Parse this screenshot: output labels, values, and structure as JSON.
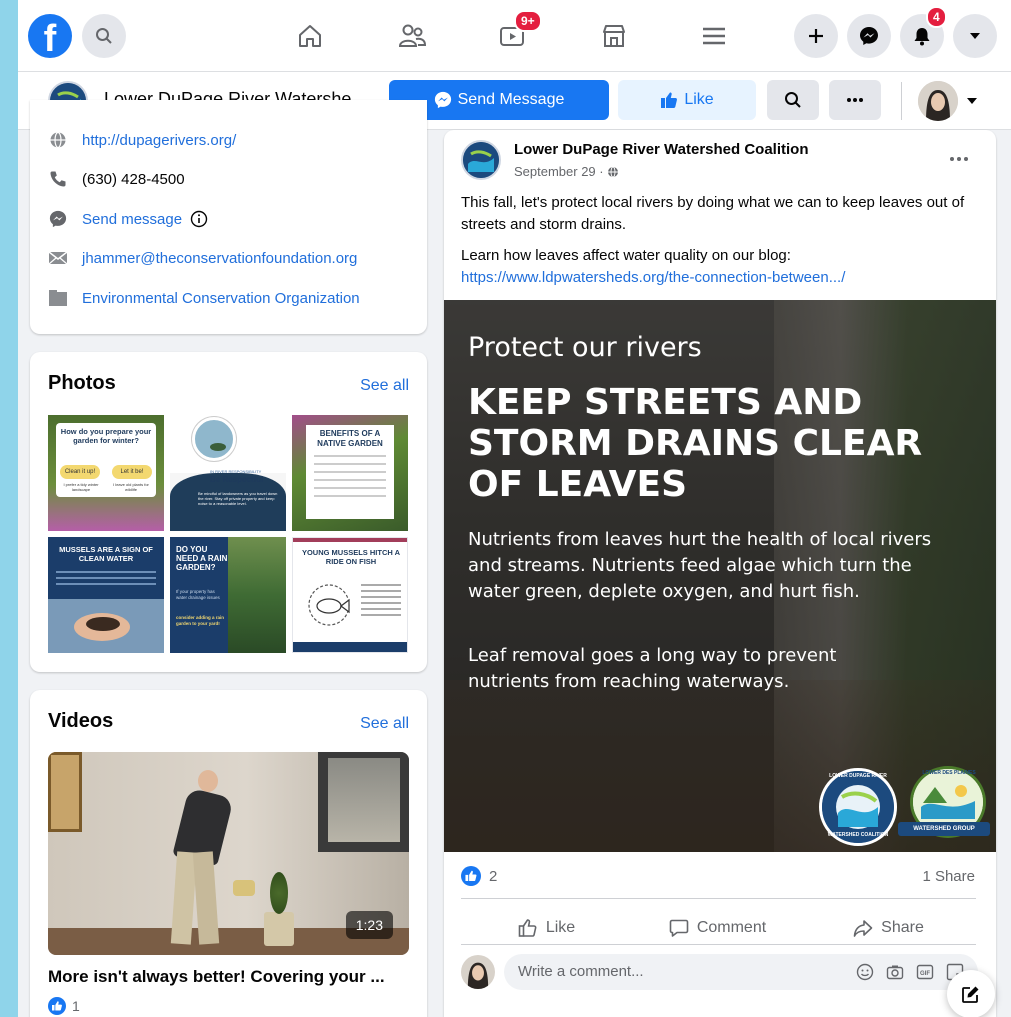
{
  "topbar": {
    "logo": "f",
    "notifications_badge": "4",
    "watch_badge": "9+"
  },
  "page_header": {
    "name": "Lower DuPage River Watershe...",
    "send_message": "Send Message",
    "like": "Like"
  },
  "intro": {
    "website": "http://dupagerivers.org/",
    "phone": "(630) 428-4500",
    "send_message": "Send message",
    "email": "jhammer@theconservationfoundation.org",
    "category": "Environmental Conservation Organization"
  },
  "photos": {
    "title": "Photos",
    "see_all": "See all",
    "items": [
      {
        "title": "How do you prepare your garden for winter?",
        "chip_a": "Clean it up!",
        "chip_b": "Let it be!",
        "sub_a": "I prefer a tidy winter landscape",
        "sub_b": "I leave old plants for wildlife"
      },
      {
        "title": "Be Respectful",
        "sub": "Be mindful of landowners as you travel down the river. Stay off private property and keep noise to a reasonable level.",
        "tag": "IN RIVER RESPONSIBILITY"
      },
      {
        "title": "BENEFITS OF A NATIVE GARDEN"
      },
      {
        "title": "MUSSELS ARE A SIGN OF CLEAN WATER"
      },
      {
        "title": "DO YOU NEED A RAIN GARDEN?",
        "sub": "If your property has water drainage issues",
        "sub2": "consider adding a rain garden to your yard!"
      },
      {
        "title": "YOUNG MUSSELS HITCH A RIDE ON FISH"
      }
    ]
  },
  "videos": {
    "title": "Videos",
    "see_all": "See all",
    "duration": "1:23",
    "caption": "More isn't always better! Covering your ...",
    "likes": "1"
  },
  "post": {
    "author": "Lower DuPage River Watershed Coalition",
    "date": "September 29 ·",
    "text1": "This fall, let's protect local rivers by doing what we can to keep leaves out of streets and storm drains.",
    "text2": "Learn how leaves affect water quality on our blog:",
    "link": "https://www.ldpwatersheds.org/the-connection-between.../",
    "image": {
      "kicker": "Protect our rivers",
      "headline1": "KEEP STREETS AND",
      "headline2": "STORM DRAINS CLEAR",
      "headline3": "OF LEAVES",
      "body1": "Nutrients from leaves hurt the health of local rivers and streams. Nutrients feed algae which turn the water green, deplete oxygen, and hurt fish.",
      "body2": "Leaf removal goes a long way to prevent nutrients from reaching waterways.",
      "logo1_top": "LOWER DUPAGE RIVER",
      "logo1_bottom": "WATERSHED COALITION",
      "logo2_top": "LOWER DES PLAINES",
      "logo2_bottom": "WATERSHED GROUP"
    },
    "reactions_count": "2",
    "shares": "1 Share",
    "like": "Like",
    "comment": "Comment",
    "share": "Share",
    "comment_placeholder": "Write a comment..."
  },
  "colors": {
    "brand_blue": "#1877f2",
    "badge_red": "#e41e3f",
    "link_blue": "#216fdb"
  }
}
